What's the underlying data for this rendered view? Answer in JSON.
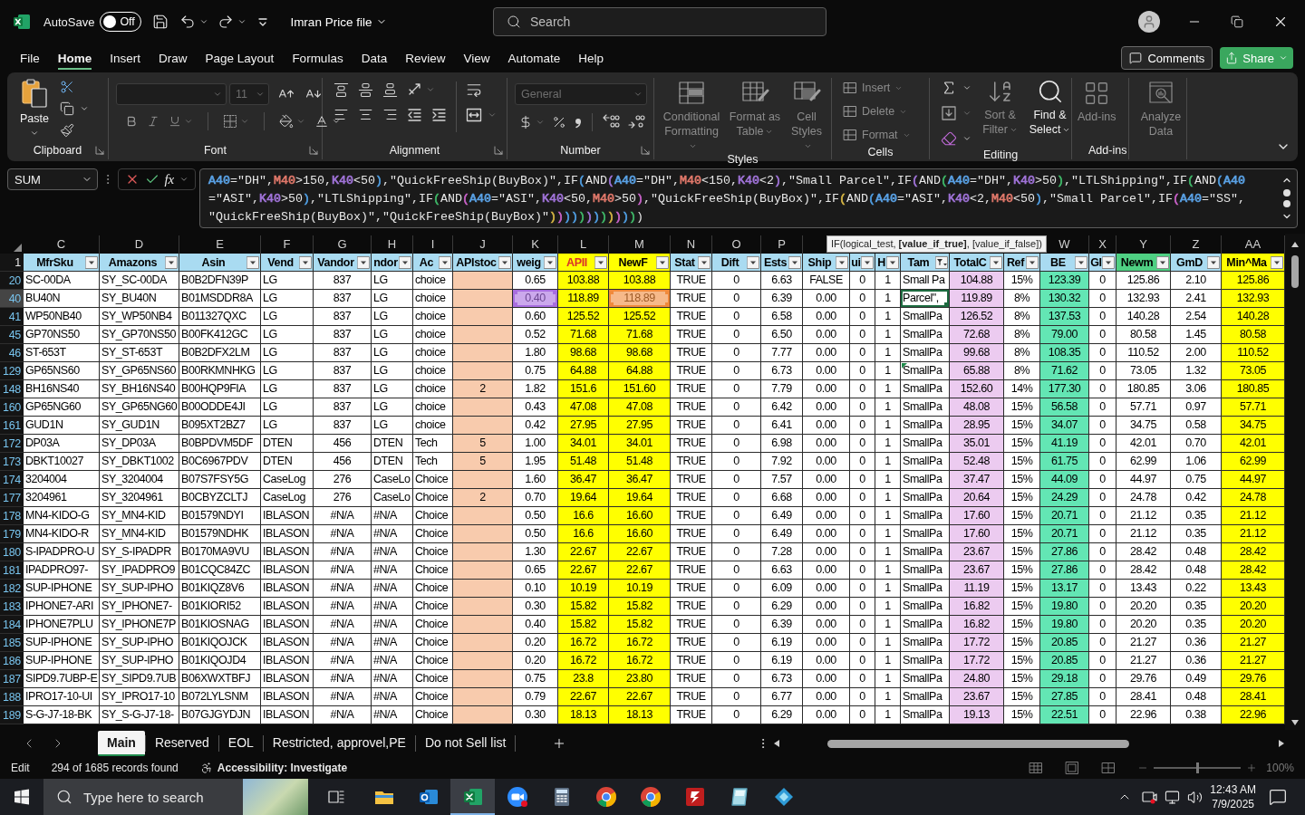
{
  "title_bar": {
    "autosave_label": "AutoSave",
    "autosave": {
      "on": false,
      "label": "Off"
    },
    "file_name": "Imran Price file",
    "search": {
      "placeholder": "Search"
    }
  },
  "menu": {
    "tabs": [
      {
        "label": "File",
        "selected": false
      },
      {
        "label": "Home",
        "selected": true
      },
      {
        "label": "Insert",
        "selected": false
      },
      {
        "label": "Draw",
        "selected": false
      },
      {
        "label": "Page Layout",
        "selected": false
      },
      {
        "label": "Formulas",
        "selected": false
      },
      {
        "label": "Data",
        "selected": false
      },
      {
        "label": "Review",
        "selected": false
      },
      {
        "label": "View",
        "selected": false
      },
      {
        "label": "Automate",
        "selected": false
      },
      {
        "label": "Help",
        "selected": false
      }
    ],
    "comments": "Comments",
    "share": "Share"
  },
  "ribbon": {
    "clipboard": {
      "label": "Clipboard",
      "paste": {
        "label": "Paste",
        "disabled": false
      }
    },
    "font": {
      "label": "Font",
      "font_size": {
        "value": "11",
        "disabled": true
      }
    },
    "alignment": {
      "label": "Alignment"
    },
    "number": {
      "label": "Number",
      "format": {
        "value": "General",
        "disabled": true
      }
    },
    "styles": {
      "label": "Styles",
      "commands": [
        {
          "label": "Conditional Formatting",
          "disabled": true
        },
        {
          "label": "Format as Table",
          "disabled": true
        },
        {
          "label": "Cell Styles",
          "disabled": true
        }
      ]
    },
    "cells": {
      "label": "Cells",
      "commands": [
        {
          "label": "Insert",
          "disabled": true
        },
        {
          "label": "Delete",
          "disabled": true
        },
        {
          "label": "Format",
          "disabled": true
        }
      ]
    },
    "editing": {
      "label": "Editing",
      "commands": [
        {
          "label": "Sort & Filter",
          "disabled": true
        },
        {
          "label": "Find & Select",
          "disabled": false
        }
      ]
    },
    "add_ins": {
      "label": "Add-ins",
      "commands": [
        {
          "label": "Add-ins",
          "disabled": true
        },
        {
          "label": "Analyze Data",
          "disabled": true
        }
      ]
    }
  },
  "formula_bar": {
    "name_box": "SUM",
    "insert_function": "fx",
    "lines": [
      [
        {
          "text": "A40",
          "color": "#5aa2e6"
        },
        {
          "text": "=\"DH\","
        },
        {
          "text": "M40",
          "color": "#e0786a"
        },
        {
          "text": ">150,"
        },
        {
          "text": "K40",
          "color": "#a073d8"
        },
        {
          "text": "<50"
        },
        {
          "text": ")",
          "color": "#4f9de0"
        },
        {
          "text": ",\"QuickFreeShip(BuyBox)\",IF"
        },
        {
          "text": "(",
          "color": "#4f9de0"
        },
        {
          "text": "AND"
        },
        {
          "text": "(",
          "color": "#a073d8"
        },
        {
          "text": "A40",
          "color": "#5aa2e6"
        },
        {
          "text": "=\"DH\","
        },
        {
          "text": "M40",
          "color": "#e0786a"
        },
        {
          "text": "<150,"
        },
        {
          "text": "K40",
          "color": "#a073d8"
        },
        {
          "text": "<2"
        },
        {
          "text": ")",
          "color": "#a073d8"
        },
        {
          "text": ",\"Small Parcel\",IF"
        },
        {
          "text": "(",
          "color": "#a073d8"
        },
        {
          "text": "AND"
        },
        {
          "text": "(",
          "color": "#3fb868"
        },
        {
          "text": "A40",
          "color": "#5aa2e6"
        },
        {
          "text": "=\"DH\","
        },
        {
          "text": "K40",
          "color": "#a073d8"
        },
        {
          "text": ">50"
        },
        {
          "text": ")",
          "color": "#3fb868"
        },
        {
          "text": ",\"LTLShipping\",IF"
        },
        {
          "text": "(",
          "color": "#3fb868"
        },
        {
          "text": "AND"
        },
        {
          "text": "(",
          "color": "#4f9de0"
        },
        {
          "text": "A40",
          "color": "#5aa2e6"
        }
      ],
      [
        {
          "text": "=\"ASI\","
        },
        {
          "text": "K40",
          "color": "#a073d8"
        },
        {
          "text": ">50"
        },
        {
          "text": ")",
          "color": "#4f9de0"
        },
        {
          "text": ",\"LTLShipping\",IF"
        },
        {
          "text": "(",
          "color": "#3fb868"
        },
        {
          "text": "AND"
        },
        {
          "text": "(",
          "color": "#c862c8"
        },
        {
          "text": "A40",
          "color": "#5aa2e6"
        },
        {
          "text": "=\"ASI\","
        },
        {
          "text": "K40",
          "color": "#a073d8"
        },
        {
          "text": "<50,"
        },
        {
          "text": "M40",
          "color": "#e0786a"
        },
        {
          "text": ">50"
        },
        {
          "text": ")",
          "color": "#c862c8"
        },
        {
          "text": ",\"QuickFreeShip(BuyBox)\",IF"
        },
        {
          "text": "(",
          "color": "#d4b443"
        },
        {
          "text": "AND"
        },
        {
          "text": "(",
          "color": "#4f9de0"
        },
        {
          "text": "A40",
          "color": "#5aa2e6"
        },
        {
          "text": "=\"ASI\","
        },
        {
          "text": "K40",
          "color": "#a073d8"
        },
        {
          "text": "<2,"
        },
        {
          "text": "M40",
          "color": "#e0786a"
        },
        {
          "text": "<50"
        },
        {
          "text": ")",
          "color": "#4f9de0"
        },
        {
          "text": ",\"Small Parcel\",IF"
        },
        {
          "text": "(",
          "color": "#c862c8"
        },
        {
          "text": "A40",
          "color": "#5aa2e6"
        },
        {
          "text": "=\"SS\","
        }
      ],
      [
        {
          "text": "\"QuickFreeShip(BuyBox)\",\"QuickFreeShip(BuyBox)\""
        },
        {
          "text": ")",
          "color": "#d4b443"
        },
        {
          "text": ")",
          "color": "#c862c8"
        },
        {
          "text": ")",
          "color": "#4f9de0"
        },
        {
          "text": ")",
          "color": "#4f9de0"
        },
        {
          "text": ")",
          "color": "#3fb868"
        },
        {
          "text": ")",
          "color": "#a073d8"
        },
        {
          "text": ")",
          "color": "#4f9de0"
        },
        {
          "text": ")",
          "color": "#3fb868"
        },
        {
          "text": ")",
          "color": "#d4b443"
        },
        {
          "text": ")",
          "color": "#c862c8"
        },
        {
          "text": ")",
          "color": "#4f9de0"
        },
        {
          "text": ")",
          "color": "#3fb868"
        },
        {
          "text": ")"
        }
      ]
    ]
  },
  "sheet": {
    "header_row": "1",
    "tooltip": "IF(logical_test, **[value_if_true]**, [value_if_false])",
    "columns": [
      {
        "letter": "C",
        "header": "MfrSku",
        "filtered": false
      },
      {
        "letter": "D",
        "header": "Amazons",
        "filtered": false
      },
      {
        "letter": "E",
        "header": "Asin",
        "filtered": false
      },
      {
        "letter": "F",
        "header": "Vend",
        "filtered": false
      },
      {
        "letter": "G",
        "header": "Vandor",
        "filtered": false
      },
      {
        "letter": "H",
        "header": "ndor",
        "filtered": false
      },
      {
        "letter": "I",
        "header": "Ac",
        "filtered": false
      },
      {
        "letter": "J",
        "header": "APIstoc",
        "filtered": false,
        "color": "#f8cbad"
      },
      {
        "letter": "K",
        "header": "weig",
        "filtered": false
      },
      {
        "letter": "L",
        "header": "APII",
        "filtered": false,
        "color": "#ffff00",
        "header_fill": {
          "color": "#ffff00"
        },
        "header_text": {
          "color": "#d9302a"
        }
      },
      {
        "letter": "M",
        "header": "NewF",
        "filtered": false,
        "color": "#ffff00",
        "header_fill": {
          "color": "#ffff00"
        }
      },
      {
        "letter": "N",
        "header": "Stat",
        "filtered": false
      },
      {
        "letter": "O",
        "header": "Dift",
        "filtered": false
      },
      {
        "letter": "P",
        "header": "Ests",
        "filtered": false
      },
      {
        "header": "Ship",
        "filtered": false
      },
      {
        "header": "ui",
        "filtered": false
      },
      {
        "header": "H",
        "filtered": false
      },
      {
        "header": "Tam",
        "filtered": true
      },
      {
        "header": "TotalC",
        "filtered": false,
        "color": "#eccbf0"
      },
      {
        "header": "Ref",
        "filtered": false
      },
      {
        "letter": "W",
        "header": "BE",
        "filtered": false,
        "color": "#63e6b4"
      },
      {
        "letter": "X",
        "header": "GI",
        "filtered": false
      },
      {
        "letter": "Y",
        "header": "Newm",
        "filtered": false,
        "header_fill": {
          "color": "#4fd083"
        }
      },
      {
        "letter": "Z",
        "header": "GmD",
        "filtered": false
      },
      {
        "letter": "AA",
        "header": "Min^Ma",
        "filtered": false,
        "color": "#ffff00",
        "header_fill": {
          "color": "#ffff00"
        }
      }
    ],
    "rows": [
      {
        "number": "20",
        "cells": [
          "SC-00DA",
          "SY_SC-00DA",
          "B0B2DFN39P",
          "LG",
          "837",
          "LG",
          "choice",
          null,
          "0.65",
          "103.88",
          "103.88",
          "TRUE",
          "0",
          "6.63",
          "FALSE",
          "0",
          "1",
          "Small Pa",
          "104.88",
          "15%",
          "123.39",
          "0",
          "125.86",
          "2.10",
          "125.86"
        ]
      },
      {
        "number": "40",
        "cells": [
          "BU40N",
          "SY_BU40N",
          "B01MSDDR8A",
          "LG",
          "837",
          "LG",
          "choice",
          null,
          {
            "text": "0.40",
            "color": "#a86ee0"
          },
          "118.89",
          {
            "text": "118.89",
            "color": "#f08a3c"
          },
          "TRUE",
          "0",
          "6.39",
          "0.00",
          "0",
          "1",
          {
            "text": "Parcel\",",
            "editing": true
          },
          "119.89",
          "8%",
          "130.32",
          "0",
          "132.93",
          "2.41",
          "132.93"
        ]
      },
      {
        "number": "41",
        "cells": [
          "WP50NB40",
          "SY_WP50NB4",
          "B011327QXC",
          "LG",
          "837",
          "LG",
          "choice",
          null,
          "0.60",
          "125.52",
          "125.52",
          "TRUE",
          "0",
          "6.58",
          "0.00",
          "0",
          "1",
          "SmallPa",
          "126.52",
          "8%",
          "137.53",
          "0",
          "140.28",
          "2.54",
          "140.28"
        ]
      },
      {
        "number": "45",
        "cells": [
          "GP70NS50",
          "SY_GP70NS50",
          "B00FK412GC",
          "LG",
          "837",
          "LG",
          "choice",
          null,
          "0.52",
          "71.68",
          "71.68",
          "TRUE",
          "0",
          "6.50",
          "0.00",
          "0",
          "1",
          "SmallPa",
          "72.68",
          "8%",
          "79.00",
          "0",
          "80.58",
          "1.45",
          "80.58"
        ]
      },
      {
        "number": "46",
        "cells": [
          "ST-653T",
          "SY_ST-653T",
          "B0B2DFX2LM",
          "LG",
          "837",
          "LG",
          "choice",
          null,
          "1.80",
          "98.68",
          "98.68",
          "TRUE",
          "0",
          "7.77",
          "0.00",
          "0",
          "1",
          "SmallPa",
          "99.68",
          "8%",
          "108.35",
          "0",
          "110.52",
          "2.00",
          "110.52"
        ]
      },
      {
        "number": "129",
        "cells": [
          "GP65NS60",
          "SY_GP65NS60",
          "B00RKMNHKG",
          "LG",
          "837",
          "LG",
          "choice",
          null,
          "0.75",
          "64.88",
          "64.88",
          "TRUE",
          "0",
          "6.73",
          "0.00",
          "0",
          "1",
          {
            "text": "SmallPa",
            "flagged": true
          },
          "65.88",
          "8%",
          "71.62",
          "0",
          "73.05",
          "1.32",
          "73.05"
        ]
      },
      {
        "number": "148",
        "cells": [
          "BH16NS40",
          "SY_BH16NS40",
          "B00HQP9FIA",
          "LG",
          "837",
          "LG",
          "choice",
          "2",
          "1.82",
          "151.6",
          "151.60",
          "TRUE",
          "0",
          "7.79",
          "0.00",
          "0",
          "1",
          "SmallPa",
          "152.60",
          "14%",
          "177.30",
          "0",
          "180.85",
          "3.06",
          "180.85"
        ]
      },
      {
        "number": "160",
        "cells": [
          "GP65NG60",
          "SY_GP65NG60",
          "B00ODDE4JI",
          "LG",
          "837",
          "LG",
          "choice",
          null,
          "0.43",
          "47.08",
          "47.08",
          "TRUE",
          "0",
          "6.42",
          "0.00",
          "0",
          "1",
          "SmallPa",
          "48.08",
          "15%",
          "56.58",
          "0",
          "57.71",
          "0.97",
          "57.71"
        ]
      },
      {
        "number": "161",
        "cells": [
          "GUD1N",
          "SY_GUD1N",
          "B095XT2BZ7",
          "LG",
          "837",
          "LG",
          "choice",
          null,
          "0.42",
          "27.95",
          "27.95",
          "TRUE",
          "0",
          "6.41",
          "0.00",
          "0",
          "1",
          "SmallPa",
          "28.95",
          "15%",
          "34.07",
          "0",
          "34.75",
          "0.58",
          "34.75"
        ]
      },
      {
        "number": "172",
        "cells": [
          "DP03A",
          "SY_DP03A",
          "B0BPDVM5DF",
          "DTEN",
          "456",
          "DTEN",
          "Tech",
          "5",
          "1.00",
          "34.01",
          "34.01",
          "TRUE",
          "0",
          "6.98",
          "0.00",
          "0",
          "1",
          "SmallPa",
          "35.01",
          "15%",
          "41.19",
          "0",
          "42.01",
          "0.70",
          "42.01"
        ]
      },
      {
        "number": "173",
        "cells": [
          "DBKT10027",
          "SY_DBKT1002",
          "B0C6967PDV",
          "DTEN",
          "456",
          "DTEN",
          "Tech",
          "5",
          "1.95",
          "51.48",
          "51.48",
          "TRUE",
          "0",
          "7.92",
          "0.00",
          "0",
          "1",
          "SmallPa",
          "52.48",
          "15%",
          "61.75",
          "0",
          "62.99",
          "1.06",
          "62.99"
        ]
      },
      {
        "number": "174",
        "cells": [
          "3204004",
          "SY_3204004",
          "B07S7FSY5G",
          "CaseLog",
          "276",
          "CaseLo",
          "Choice",
          null,
          "1.60",
          "36.47",
          "36.47",
          "TRUE",
          "0",
          "7.57",
          "0.00",
          "0",
          "1",
          "SmallPa",
          "37.47",
          "15%",
          "44.09",
          "0",
          "44.97",
          "0.75",
          "44.97"
        ]
      },
      {
        "number": "177",
        "cells": [
          "3204961",
          "SY_3204961",
          "B0CBYZCLTJ",
          "CaseLog",
          "276",
          "CaseLo",
          "Choice",
          "2",
          "0.70",
          "19.64",
          "19.64",
          "TRUE",
          "0",
          "6.68",
          "0.00",
          "0",
          "1",
          "SmallPa",
          "20.64",
          "15%",
          "24.29",
          "0",
          "24.78",
          "0.42",
          "24.78"
        ]
      },
      {
        "number": "178",
        "cells": [
          "MN4-KIDO-G",
          "SY_MN4-KID",
          "B01579NDYI",
          "IBLASON",
          "#N/A",
          "#N/A",
          "Choice",
          null,
          "0.50",
          "16.6",
          "16.60",
          "TRUE",
          "0",
          "6.49",
          "0.00",
          "0",
          "1",
          "SmallPa",
          "17.60",
          "15%",
          "20.71",
          "0",
          "21.12",
          "0.35",
          "21.12"
        ]
      },
      {
        "number": "179",
        "cells": [
          "MN4-KIDO-R",
          "SY_MN4-KID",
          "B01579NDHK",
          "IBLASON",
          "#N/A",
          "#N/A",
          "Choice",
          null,
          "0.50",
          "16.6",
          "16.60",
          "TRUE",
          "0",
          "6.49",
          "0.00",
          "0",
          "1",
          "SmallPa",
          "17.60",
          "15%",
          "20.71",
          "0",
          "21.12",
          "0.35",
          "21.12"
        ]
      },
      {
        "number": "180",
        "cells": [
          "S-IPADPRO-U",
          "SY_S-IPADPR",
          "B0170MA9VU",
          "IBLASON",
          "#N/A",
          "#N/A",
          "Choice",
          null,
          "1.30",
          "22.67",
          "22.67",
          "TRUE",
          "0",
          "7.28",
          "0.00",
          "0",
          "1",
          "SmallPa",
          "23.67",
          "15%",
          "27.86",
          "0",
          "28.42",
          "0.48",
          "28.42"
        ]
      },
      {
        "number": "181",
        "cells": [
          "IPADPRO97-",
          "SY_IPADPRO9",
          "B01CQC84ZC",
          "IBLASON",
          "#N/A",
          "#N/A",
          "Choice",
          null,
          "0.65",
          "22.67",
          "22.67",
          "TRUE",
          "0",
          "6.63",
          "0.00",
          "0",
          "1",
          "SmallPa",
          "23.67",
          "15%",
          "27.86",
          "0",
          "28.42",
          "0.48",
          "28.42"
        ]
      },
      {
        "number": "182",
        "cells": [
          "SUP-IPHONE",
          "SY_SUP-IPHO",
          "B01KIQZ8V6",
          "IBLASON",
          "#N/A",
          "#N/A",
          "Choice",
          null,
          "0.10",
          "10.19",
          "10.19",
          "TRUE",
          "0",
          "6.09",
          "0.00",
          "0",
          "1",
          "SmallPa",
          "11.19",
          "15%",
          "13.17",
          "0",
          "13.43",
          "0.22",
          "13.43"
        ]
      },
      {
        "number": "183",
        "cells": [
          "IPHONE7-ARI",
          "SY_IPHONE7-",
          "B01KIORI52",
          "IBLASON",
          "#N/A",
          "#N/A",
          "Choice",
          null,
          "0.30",
          "15.82",
          "15.82",
          "TRUE",
          "0",
          "6.29",
          "0.00",
          "0",
          "1",
          "SmallPa",
          "16.82",
          "15%",
          "19.80",
          "0",
          "20.20",
          "0.35",
          "20.20"
        ]
      },
      {
        "number": "184",
        "cells": [
          "IPHONE7PLU",
          "SY_IPHONE7P",
          "B01KIOSNAG",
          "IBLASON",
          "#N/A",
          "#N/A",
          "Choice",
          null,
          "0.40",
          "15.82",
          "15.82",
          "TRUE",
          "0",
          "6.39",
          "0.00",
          "0",
          "1",
          "SmallPa",
          "16.82",
          "15%",
          "19.80",
          "0",
          "20.20",
          "0.35",
          "20.20"
        ]
      },
      {
        "number": "185",
        "cells": [
          "SUP-IPHONE",
          "SY_SUP-IPHO",
          "B01KIQOJCK",
          "IBLASON",
          "#N/A",
          "#N/A",
          "Choice",
          null,
          "0.20",
          "16.72",
          "16.72",
          "TRUE",
          "0",
          "6.19",
          "0.00",
          "0",
          "1",
          "SmallPa",
          "17.72",
          "15%",
          "20.85",
          "0",
          "21.27",
          "0.36",
          "21.27"
        ]
      },
      {
        "number": "186",
        "cells": [
          "SUP-IPHONE",
          "SY_SUP-IPHO",
          "B01KIQOJD4",
          "IBLASON",
          "#N/A",
          "#N/A",
          "Choice",
          null,
          "0.20",
          "16.72",
          "16.72",
          "TRUE",
          "0",
          "6.19",
          "0.00",
          "0",
          "1",
          "SmallPa",
          "17.72",
          "15%",
          "20.85",
          "0",
          "21.27",
          "0.36",
          "21.27"
        ]
      },
      {
        "number": "187",
        "cells": [
          "SIPD9.7UBP-E",
          "SY_SIPD9.7UB",
          "B06XWXTBFJ",
          "IBLASON",
          "#N/A",
          "#N/A",
          "Choice",
          null,
          "0.75",
          "23.8",
          "23.80",
          "TRUE",
          "0",
          "6.73",
          "0.00",
          "0",
          "1",
          "SmallPa",
          "24.80",
          "15%",
          "29.18",
          "0",
          "29.76",
          "0.49",
          "29.76"
        ]
      },
      {
        "number": "188",
        "cells": [
          "IPRO17-10-UI",
          "SY_IPRO17-10",
          "B072LYLSNM",
          "IBLASON",
          "#N/A",
          "#N/A",
          "Choice",
          null,
          "0.79",
          "22.67",
          "22.67",
          "TRUE",
          "0",
          "6.77",
          "0.00",
          "0",
          "1",
          "SmallPa",
          "23.67",
          "15%",
          "27.85",
          "0",
          "28.41",
          "0.48",
          "28.41"
        ]
      },
      {
        "number": "189",
        "cells": [
          "S-G-J7-18-BK",
          "SY_S-G-J7-18-",
          "B07GJGYDJN",
          "IBLASON",
          "#N/A",
          "#N/A",
          "Choice",
          null,
          "0.30",
          "18.13",
          "18.13",
          "TRUE",
          "0",
          "6.29",
          "0.00",
          "0",
          "1",
          "SmallPa",
          "19.13",
          "15%",
          "22.51",
          "0",
          "22.96",
          "0.38",
          "22.96"
        ]
      }
    ]
  },
  "sheet_tabs": [
    {
      "label": "Main",
      "selected": true
    },
    {
      "label": "Reserved",
      "selected": false
    },
    {
      "label": "EOL",
      "selected": false
    },
    {
      "label": "Restricted, approvel,PE",
      "selected": false
    },
    {
      "label": "Do not Sell list",
      "selected": false
    }
  ],
  "status_bar": {
    "mode": "Edit",
    "records": "294 of 1685 records found",
    "accessibility": "Accessibility: Investigate",
    "zoom": {
      "level": 0.5,
      "label": "100%"
    }
  },
  "taskbar": {
    "search": {
      "placeholder": "Type here to search"
    },
    "apps": [
      {
        "kind": "explorer",
        "active": false
      },
      {
        "kind": "outlook",
        "active": false
      },
      {
        "kind": "excel",
        "active": true
      },
      {
        "kind": "zoom",
        "active": false,
        "notification": true
      },
      {
        "kind": "calculator",
        "active": false
      },
      {
        "kind": "chrome",
        "active": false
      },
      {
        "kind": "chrome",
        "active": false
      },
      {
        "kind": "filezilla",
        "active": false
      },
      {
        "kind": "glass",
        "active": false
      },
      {
        "kind": "diamond",
        "active": false
      }
    ],
    "time": "12:43 AM",
    "date": "7/9/2025"
  }
}
